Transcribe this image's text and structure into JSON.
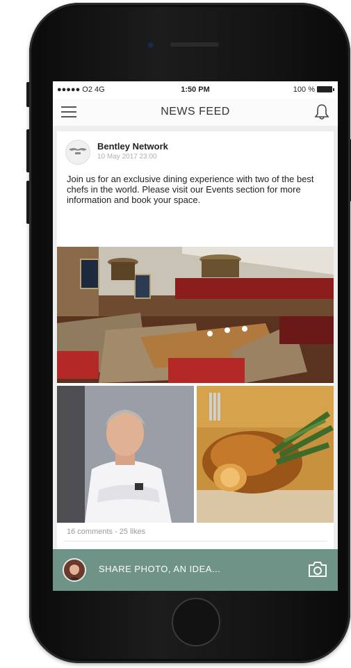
{
  "status_bar": {
    "carrier": "●●●●● O2 4G",
    "time": "1:50 PM",
    "battery": "100 %"
  },
  "header": {
    "title": "NEWS FEED",
    "menu_icon": "hamburger-menu-icon",
    "notification_icon": "bell-icon"
  },
  "post": {
    "author": "Bentley Network",
    "date": "10 May 2017 23:00",
    "text": "Join us for an exclusive dining experience with two of the best chefs in the world. Please visit our Events section for more information and book your space.",
    "stats": "16 comments - 25 likes",
    "images": [
      "restaurant-interior-photo",
      "chef-portrait-photo",
      "roast-chicken-dish-photo"
    ]
  },
  "composer": {
    "placeholder": "SHARE PHOTO, AN IDEA...",
    "camera_icon": "camera-icon"
  },
  "colors": {
    "accent": "#6f9387",
    "text": "#222222",
    "muted": "#b0b0b0"
  }
}
